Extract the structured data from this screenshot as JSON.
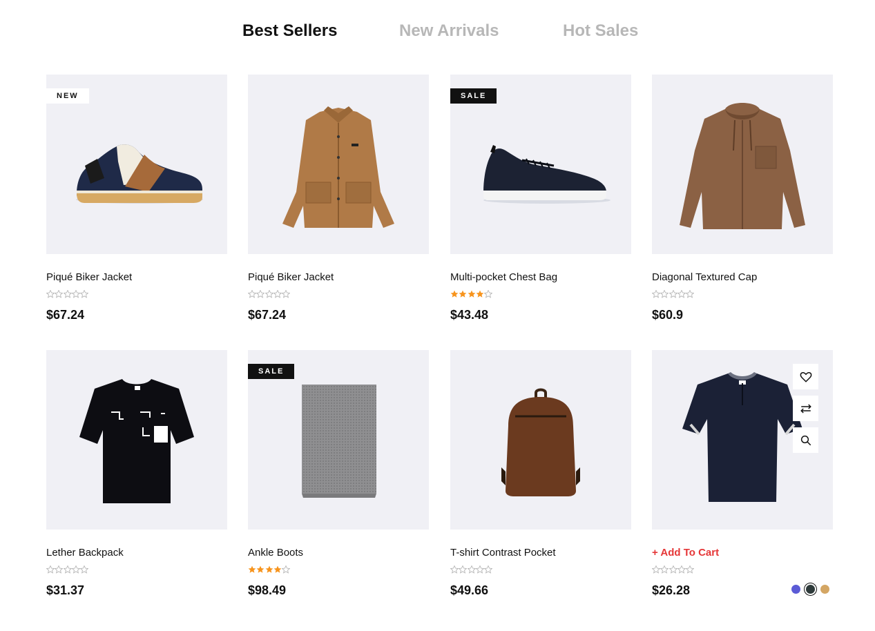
{
  "tabs": [
    {
      "label": "Best Sellers",
      "active": true
    },
    {
      "label": "New Arrivals",
      "active": false
    },
    {
      "label": "Hot Sales",
      "active": false
    }
  ],
  "colors": {
    "tab_active": "#111111",
    "tab_inactive": "#b7b7b7",
    "image_bg": "#f0f0f5",
    "star_filled": "#f7941d",
    "star_empty": "#b7b7b7",
    "add_to_cart": "#e53637"
  },
  "products": [
    {
      "name": "Piqué Biker Jacket",
      "price": "$67.24",
      "rating": 0,
      "badge": "NEW",
      "image": "sneaker-icon"
    },
    {
      "name": "Piqué Biker Jacket",
      "price": "$67.24",
      "rating": 0,
      "badge": "",
      "image": "jacket-icon"
    },
    {
      "name": "Multi-pocket Chest Bag",
      "price": "$43.48",
      "rating": 4,
      "badge": "SALE",
      "image": "sneaker-icon"
    },
    {
      "name": "Diagonal Textured Cap",
      "price": "$60.9",
      "rating": 0,
      "badge": "",
      "image": "hoodie-icon"
    },
    {
      "name": "Lether Backpack",
      "price": "$31.37",
      "rating": 0,
      "badge": "",
      "image": "tshirt-icon"
    },
    {
      "name": "Ankle Boots",
      "price": "$98.49",
      "rating": 4,
      "badge": "SALE",
      "image": "scarf-icon"
    },
    {
      "name": "T-shirt Contrast Pocket",
      "price": "$49.66",
      "rating": 0,
      "badge": "",
      "image": "backpack-icon"
    },
    {
      "name": "",
      "price": "$26.28",
      "rating": 0,
      "badge": "",
      "image": "polo-shirt-icon",
      "add_to_cart": "+ Add To Cart",
      "actions": [
        "heart-icon",
        "compare-icon",
        "search-icon"
      ],
      "swatches": [
        {
          "color": "#5b5bd6",
          "active": false
        },
        {
          "color": "#2e3a3a",
          "active": true
        },
        {
          "color": "#d4a664",
          "active": false
        }
      ]
    }
  ]
}
